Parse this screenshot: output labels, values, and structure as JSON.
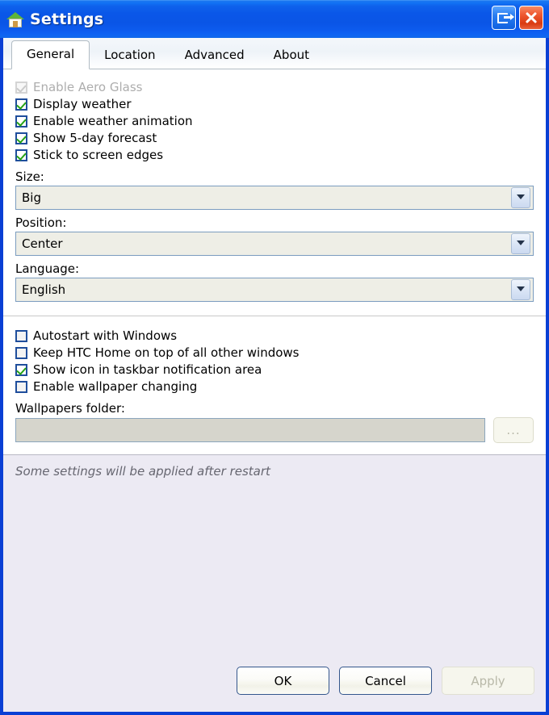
{
  "window": {
    "title": "Settings",
    "app_icon": "house-icon",
    "buttons": [
      {
        "name": "minimize-to-tray",
        "icon": "tray-icon"
      },
      {
        "name": "close",
        "icon": "close-icon"
      }
    ]
  },
  "tabs": [
    {
      "label": "General",
      "active": true
    },
    {
      "label": "Location",
      "active": false
    },
    {
      "label": "Advanced",
      "active": false
    },
    {
      "label": "About",
      "active": false
    }
  ],
  "general": {
    "checkboxes_top": [
      {
        "label": "Enable Aero Glass",
        "checked": true,
        "disabled": true
      },
      {
        "label": "Display weather",
        "checked": true,
        "disabled": false
      },
      {
        "label": "Enable weather animation",
        "checked": true,
        "disabled": false
      },
      {
        "label": "Show 5-day forecast",
        "checked": true,
        "disabled": false
      },
      {
        "label": "Stick to screen edges",
        "checked": true,
        "disabled": false
      }
    ],
    "fields": [
      {
        "label": "Size:",
        "value": "Big"
      },
      {
        "label": "Position:",
        "value": "Center"
      },
      {
        "label": "Language:",
        "value": "English"
      }
    ],
    "checkboxes_bottom": [
      {
        "label": "Autostart with Windows",
        "checked": false,
        "disabled": false
      },
      {
        "label": "Keep HTC Home on top of all other windows",
        "checked": false,
        "disabled": false
      },
      {
        "label": "Show icon in taskbar notification area",
        "checked": true,
        "disabled": false
      },
      {
        "label": "Enable wallpaper changing",
        "checked": false,
        "disabled": false
      }
    ],
    "wallpapers": {
      "label": "Wallpapers folder:",
      "value": "",
      "placeholder": "",
      "browse_label": "..."
    }
  },
  "footer": {
    "status": "Some settings will be applied after restart",
    "buttons": [
      {
        "label": "OK",
        "disabled": false
      },
      {
        "label": "Cancel",
        "disabled": false
      },
      {
        "label": "Apply",
        "disabled": true
      }
    ]
  },
  "colors": {
    "titlebar_blue": "#0a57e8",
    "window_border": "#0a3fd4",
    "close_red": "#ef5a33",
    "check_green": "#25a215",
    "footer_bg": "#eceaf3",
    "combo_bg": "#eeeee6"
  }
}
